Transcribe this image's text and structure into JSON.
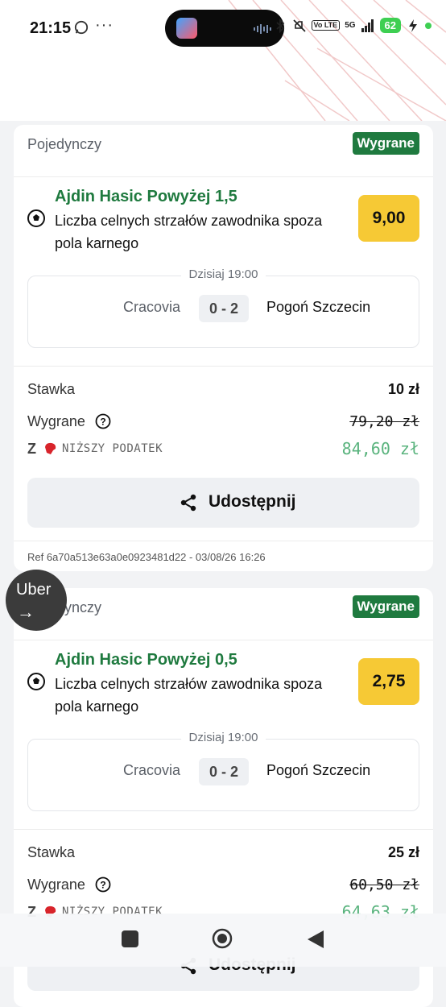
{
  "status_bar": {
    "time": "21:15",
    "dots": "···",
    "network_label": "5G",
    "volte_label": "Vo LTE",
    "battery": "62"
  },
  "bets": [
    {
      "type": "Pojedynczy",
      "status": "Wygrane",
      "selection_title": "Ajdin Hasic Powyżej 1,5",
      "market": "Liczba celnych strzałów zawodnika spoza pola karnego",
      "odds": "9,00",
      "match_time": "Dzisiaj 19:00",
      "home_team": "Cracovia",
      "score": "0 - 2",
      "away_team": "Pogoń Szczecin",
      "stake_label": "Stawka",
      "stake": "10 zł",
      "win_label": "Wygrane",
      "win_original": "79,20 zł",
      "tax_prefix": "Z",
      "tax_label": "NIŻSZY PODATEK",
      "win_after_tax": "84,60 zł",
      "share_label": "Udostępnij",
      "ref": "Ref 6a70a513e63a0e0923481d22 - 03/08/26 16:26"
    },
    {
      "type": "Pojedynczy",
      "status": "Wygrane",
      "selection_title": "Ajdin Hasic Powyżej 0,5",
      "market": "Liczba celnych strzałów zawodnika spoza pola karnego",
      "odds": "2,75",
      "match_time": "Dzisiaj 19:00",
      "home_team": "Cracovia",
      "score": "0 - 2",
      "away_team": "Pogoń Szczecin",
      "stake_label": "Stawka",
      "stake": "25 zł",
      "win_label": "Wygrane",
      "win_original": "60,50 zł",
      "tax_prefix": "Z",
      "tax_label": "NIŻSZY PODATEK",
      "win_after_tax": "64,63 zł",
      "share_label": "Udostępnij"
    }
  ],
  "uber_bubble": {
    "label": "Uber",
    "arrow": "→"
  },
  "colors": {
    "accent_green": "#1f7a3f",
    "odds_yellow": "#f6c935",
    "tax_green": "#59b37d"
  }
}
